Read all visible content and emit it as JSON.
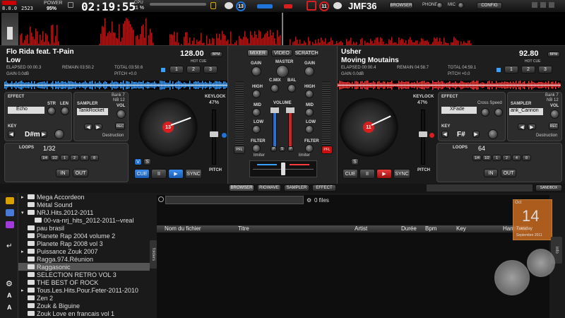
{
  "top": {
    "master_vol_label": "8.0.0",
    "master_freq": "2523",
    "power_label": "POWER",
    "power_value": "95%",
    "clock": "02:19:55",
    "cpu_label": "CPU",
    "cpu_value": "21 %",
    "deck_left_num": "13",
    "deck_right_num": "11",
    "user": "JMF36",
    "browser_btn": "BROWSER",
    "phone_label": "PHONE",
    "mic_label": "MIC",
    "config_btn": "CONFIG"
  },
  "left": {
    "artist": "Flo Rida feat. T-Pain",
    "title": "Low",
    "bpm": "128.00",
    "bpm_unit": "BPM",
    "elapsed": "ELAPSED 00:00.3",
    "remain": "REMAIN 03:50.2",
    "total": "TOTAL 03:50.6",
    "gain": "GAIN 0.0dB",
    "pitch": "PITCH +0.0",
    "hot_cue": "HOT CUE",
    "cues": [
      "1",
      "2",
      "3"
    ],
    "effect_label": "EFFECT",
    "effect": "Echo",
    "str": "STR",
    "len": "LEN",
    "sampler_label": "SAMPLER",
    "sampler": "TankRocket",
    "bank": "Bank 7",
    "nb": "NB 12",
    "vol": "VOL",
    "rec": "REC",
    "destruction": "Destruction",
    "key_label": "KEY",
    "key": "D#m",
    "keylock": "KEYLOCK",
    "keylock_pct": "47%",
    "platter_num": "13",
    "loops_label": "LOOPS",
    "loop_value": "1/32",
    "loop_sizes": [
      "1/4",
      "1/2",
      "1",
      "2",
      "4",
      "8"
    ],
    "in": "IN",
    "out": "OUT",
    "v": "V",
    "s": "S",
    "cue": "CUE",
    "play": "▶",
    "pause": "II",
    "sync": "SYNC",
    "pitch_label": "PITCH"
  },
  "right": {
    "artist": "Usher",
    "title": "Moving Moutains",
    "bpm": "92.80",
    "bpm_unit": "BPM",
    "elapsed": "ELAPSED 00:00.4",
    "remain": "REMAIN 04:58.7",
    "total": "TOTAL 04:59.1",
    "gain": "GAIN 0.0dB",
    "pitch": "PITCH +0.0",
    "hot_cue": "HOT CUE",
    "cues": [
      "1",
      "2",
      "3"
    ],
    "effect_label": "EFFECT",
    "effect": "XFade",
    "cross_speed": "Cross Speed",
    "sampler_label": "SAMPLER",
    "sampler": "ank_Cannon",
    "bank": "Bank 7",
    "nb": "NB 12",
    "vol": "VOL",
    "rec": "REC",
    "destruction": "Destruction",
    "key_label": "KEY",
    "key": "F#",
    "keylock": "KEYLOCK",
    "keylock_pct": "47%",
    "platter_num": "11",
    "loops_label": "LOOPS",
    "loop_value": "64",
    "loop_sizes": [
      "1/4",
      "1/2",
      "1",
      "2",
      "4",
      "8"
    ],
    "in": "IN",
    "out": "OUT",
    "s": "S",
    "cue": "CUE",
    "play": "▶",
    "pause": "II",
    "sync": "SYNC",
    "pitch_label": "PITCH"
  },
  "mixer": {
    "tabs": [
      "MIXER",
      "VIDEO",
      "SCRATCH"
    ],
    "gain": "GAIN",
    "master": "MASTER",
    "high": "HIGH",
    "mid": "MID",
    "low": "LOW",
    "cmix": "C.MIX",
    "bal": "BAL",
    "volume": "VOLUME",
    "filter": "FILTER",
    "pfl": "PFL",
    "limiter": "limiter",
    "p": "P",
    "s": "S"
  },
  "bottom_tabs": [
    "BROWSER",
    "RIGWAVE",
    "SAMPLER",
    "EFFECT"
  ],
  "sandbox": "SANDBOX",
  "browser": {
    "folders": [
      {
        "name": "Mega Accordeon",
        "level": 0,
        "arrow": "▸"
      },
      {
        "name": "Métal Sound",
        "level": 0,
        "arrow": ""
      },
      {
        "name": "NRJ.Hits.2012-2011",
        "level": 0,
        "arrow": "▾"
      },
      {
        "name": "00-va-nrj_hits_2012-2011--vreal",
        "level": 1,
        "arrow": ""
      },
      {
        "name": "pau brasil",
        "level": 0,
        "arrow": ""
      },
      {
        "name": "Planete Rap 2004 volume 2",
        "level": 0,
        "arrow": ""
      },
      {
        "name": "Planete Rap 2008 vol 3",
        "level": 0,
        "arrow": ""
      },
      {
        "name": "Puissance Zouk 2007",
        "level": 0,
        "arrow": "▸"
      },
      {
        "name": "Ragga.974.Réunion",
        "level": 0,
        "arrow": ""
      },
      {
        "name": "Raggasonic",
        "level": 0,
        "arrow": "",
        "selected": true
      },
      {
        "name": "SELECTION RETRO VOL 3",
        "level": 0,
        "arrow": ""
      },
      {
        "name": "THE BEST OF ROCK",
        "level": 0,
        "arrow": ""
      },
      {
        "name": "Tous.Les.Hits.Pour.Feter-2011-2010",
        "level": 0,
        "arrow": "▸"
      },
      {
        "name": "Zen 2",
        "level": 0,
        "arrow": ""
      },
      {
        "name": "Zouk & Biguine",
        "level": 0,
        "arrow": ""
      },
      {
        "name": "Zouk Love en francais vol 1",
        "level": 0,
        "arrow": ""
      }
    ],
    "folders_tab": "folders",
    "search_placeholder": "",
    "files_count": "0 files",
    "columns": [
      "Nom du fichier",
      "Titre",
      "Artist",
      "Durée",
      "Bpm",
      "Key",
      "Harmonic"
    ],
    "info_tab": "info"
  },
  "calendar": {
    "month": "Oct",
    "day": "14",
    "weekday": "Tuesday",
    "footer": "Septembre 2011"
  },
  "colors": {
    "left_wave": "#3aa0ff",
    "right_wave": "#ff3a3a",
    "accent_blue": "#1e74d8",
    "accent_red": "#d81e1e",
    "clock": "#ffffff"
  }
}
